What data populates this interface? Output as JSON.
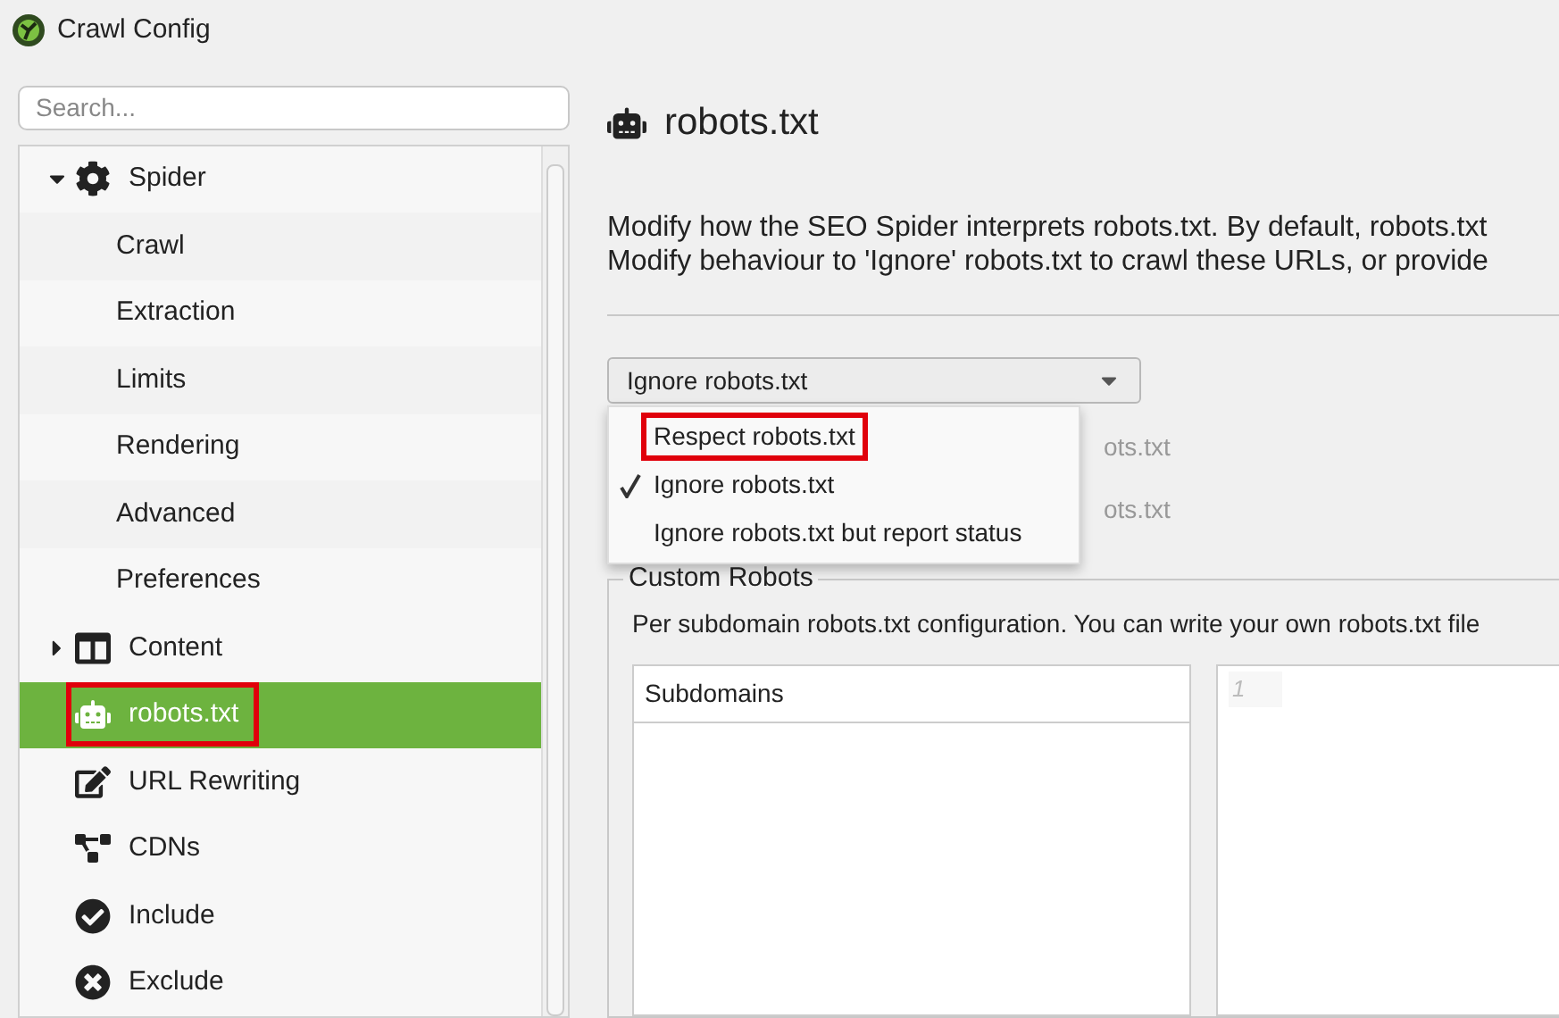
{
  "window": {
    "title": "Crawl Config"
  },
  "search": {
    "placeholder": "Search..."
  },
  "tree": [
    {
      "label": "Spider",
      "kind": "gear",
      "expanded": true,
      "selected": false,
      "highlighted": false,
      "children": [
        {
          "label": "Crawl",
          "selected": false
        },
        {
          "label": "Extraction",
          "selected": false
        },
        {
          "label": "Limits",
          "selected": false
        },
        {
          "label": "Rendering",
          "selected": false
        },
        {
          "label": "Advanced",
          "selected": false
        },
        {
          "label": "Preferences",
          "selected": false
        }
      ]
    },
    {
      "label": "Content",
      "kind": "columns",
      "expanded": false,
      "selected": false,
      "highlighted": false
    },
    {
      "label": "robots.txt",
      "kind": "robot",
      "selected": true,
      "highlighted": true
    },
    {
      "label": "URL Rewriting",
      "kind": "edit",
      "selected": false,
      "highlighted": false
    },
    {
      "label": "CDNs",
      "kind": "network",
      "selected": false,
      "highlighted": false
    },
    {
      "label": "Include",
      "kind": "check",
      "selected": false,
      "highlighted": false
    },
    {
      "label": "Exclude",
      "kind": "cross",
      "selected": false,
      "highlighted": false
    }
  ],
  "page": {
    "title": "robots.txt",
    "description": [
      "Modify how the SEO Spider interprets robots.txt. By default, robots.txt",
      "Modify behaviour to 'Ignore' robots.txt to crawl these URLs, or provide"
    ]
  },
  "dropdown": {
    "value": "Ignore robots.txt",
    "options": [
      {
        "label": "Respect robots.txt",
        "selected": false,
        "highlighted": true
      },
      {
        "label": "Ignore robots.txt",
        "selected": true,
        "highlighted": false
      },
      {
        "label": "Ignore robots.txt but report status",
        "selected": false,
        "highlighted": false
      }
    ]
  },
  "behind_menu": [
    "ots.txt",
    "ots.txt"
  ],
  "custom_robots": {
    "title": "Custom Robots",
    "description": "Per subdomain robots.txt configuration. You can write your own robots.txt file",
    "subdomains_header": "Subdomains",
    "editor_line_number": "1"
  }
}
